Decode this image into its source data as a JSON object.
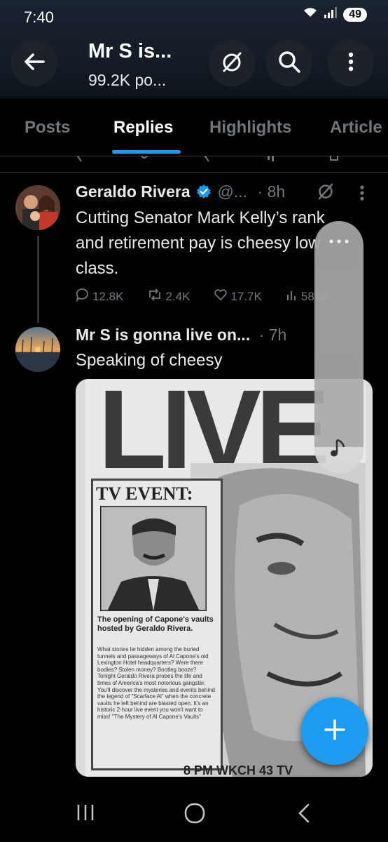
{
  "status_bar": {
    "time": "7:40",
    "battery": "49"
  },
  "header": {
    "title": "Mr S is...",
    "subtitle": "99.2K po..."
  },
  "tabs": [
    {
      "label": "Posts"
    },
    {
      "label": "Replies"
    },
    {
      "label": "Highlights"
    },
    {
      "label": "Article"
    }
  ],
  "tweets": [
    {
      "name": "Geraldo Rivera",
      "handle": "@...",
      "time": "· 8h",
      "text": "Cutting Senator Mark Kelly’s rank and retirement pay is cheesy low class.",
      "replies": "12.8K",
      "reposts": "2.4K",
      "likes": "17.7K",
      "views": "586K"
    },
    {
      "name": "Mr S is gonna live on...",
      "time": "· 7h",
      "text": "Speaking of cheesy"
    }
  ],
  "media": {
    "headline": "LIVE",
    "event_label": "TV EVENT:",
    "caption_title": "The opening of Capone's vaults hosted by Geraldo Rivera.",
    "caption_body": "What stories lie hidden among the buried tunnels and passageways of Al Capone's old Lexington Hotel headquarters? Were there bodies? Stolen money? Bootleg booze? Tonight Geraldo Rivera probes the life and times of America's most notorious gangster. You'll discover the mysteries and events behind the legend of \"Scarface Al\" when the concrete vaults he left behind are blasted open. It's an historic 2-hour live event you won't want to miss! \"The Mystery of Al Capone's Vaults\"",
    "footer": "8 PM  WKCH 43 TV"
  },
  "colors": {
    "accent": "#1d9bf0",
    "background": "#000000",
    "secondary_text": "#71767b"
  }
}
